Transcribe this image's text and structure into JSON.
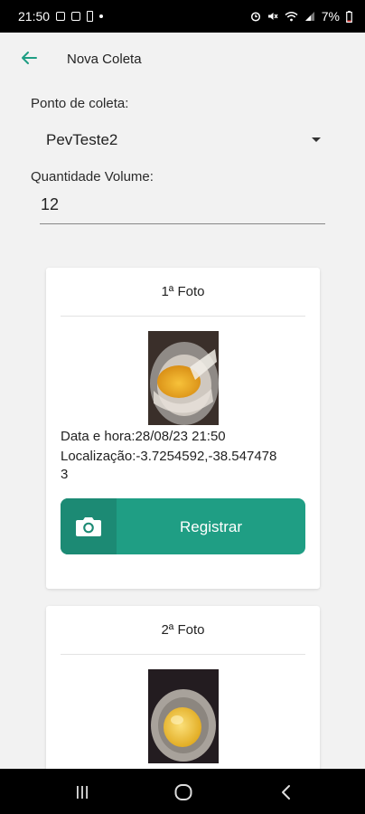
{
  "status_bar": {
    "time": "21:50",
    "battery": "7%",
    "left_icons": [
      "image-icon",
      "app-icon",
      "battery-icon",
      "dot-icon"
    ],
    "right_icons": [
      "alarm-icon",
      "mute-icon",
      "wifi-icon",
      "signal-icon",
      "battery-icon"
    ]
  },
  "app_bar": {
    "title": "Nova Coleta",
    "back_icon": "arrow-left-icon",
    "accent": "#1f9e84"
  },
  "form": {
    "collection_point_label": "Ponto de coleta:",
    "collection_point_value": "PevTeste2",
    "volume_label": "Quantidade Volume:",
    "volume_value": "12"
  },
  "photos": [
    {
      "title": "1ª Foto",
      "datetime": "Data e hora:28/08/23 21:50",
      "location_line1": "Localização:-3.7254592,-38.547478",
      "location_line2": "3",
      "button_label": "Registrar",
      "button_icon": "camera-icon"
    },
    {
      "title": "2ª Foto"
    }
  ],
  "nav_bar": {
    "icons": [
      "recents-icon",
      "home-icon",
      "back-icon"
    ]
  },
  "colors": {
    "accent": "#1f9e84",
    "accent_dark": "#1c8a74",
    "background": "#f2f2f2"
  }
}
